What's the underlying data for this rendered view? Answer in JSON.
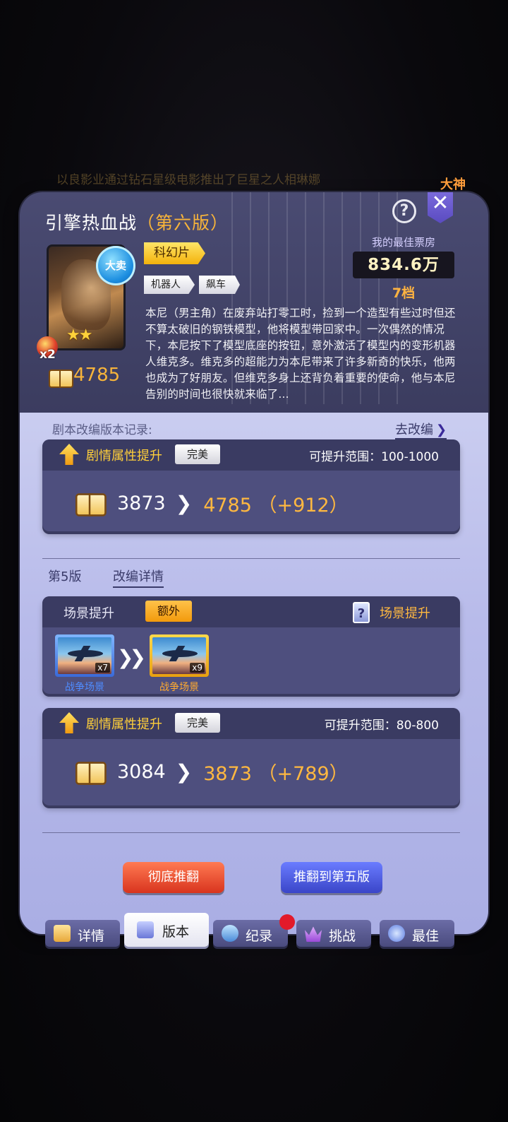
{
  "background": {
    "banner_text": "以良影业通过钻石星级电影推出了巨星之人相琳娜",
    "side_tag": "大神"
  },
  "header": {
    "title": "引擎热血战",
    "version": "（第六版）"
  },
  "poster": {
    "badge_text": "大卖",
    "stars": "★★",
    "multiplier": "x2"
  },
  "tags": {
    "genre": "科幻片",
    "sub_tags": [
      "机器人",
      "飙车"
    ]
  },
  "best": {
    "label": "我的最佳票房",
    "value": "834.6万",
    "rank": "7档"
  },
  "score": "4785",
  "description": "本尼（男主角）在废弃站打零工时，捡到一个造型有些过时但还不算太破旧的钢铁模型，他将模型带回家中。一次偶然的情况下，本尼按下了模型底座的按钮，意外激活了模型内的变形机器人维克多。维克多的超能力为本尼带来了许多新奇的快乐，他两也成为了好朋友。但维克多身上还背负着重要的使命，他与本尼告别的时间也很快就来临了...",
  "record": {
    "label": "剧本改编版本记录:",
    "goto_label": "去改编",
    "chevron": "❯"
  },
  "card1": {
    "head_label": "剧情属性提升",
    "quality": "完美",
    "range": "可提升范围：100-1000",
    "from": "3873",
    "to": "4785 （+912）"
  },
  "version_tabs": {
    "version": "第5版",
    "detail": "改编详情"
  },
  "scene": {
    "label": "场景提升",
    "extra": "额外",
    "right_label": "场景提升",
    "question_icon_text": "?",
    "from_count": "x7",
    "to_count": "x9",
    "from_name": "战争场景",
    "to_name": "战争场景"
  },
  "card2": {
    "head_label": "剧情属性提升",
    "quality": "完美",
    "range": "可提升范围：80-800",
    "from": "3084",
    "to": "3873 （+789）"
  },
  "buttons": {
    "overthrow": "彻底推翻",
    "revert": "推翻到第五版"
  },
  "tabs": [
    {
      "label": "详情"
    },
    {
      "label": "版本"
    },
    {
      "label": "纪录"
    },
    {
      "label": "挑战"
    },
    {
      "label": "最佳"
    }
  ],
  "colors": {
    "accent_gold": "#f7b43a",
    "panel": "#3b3c5f",
    "lower": "#b8bbea",
    "red_button": "#d8341e",
    "blue_button": "#3a45c8"
  }
}
